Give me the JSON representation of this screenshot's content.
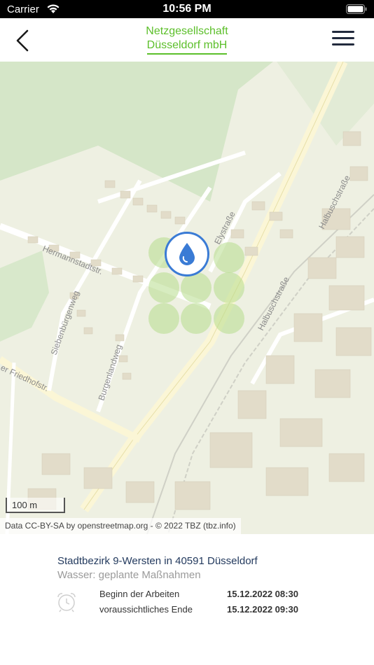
{
  "status_bar": {
    "carrier": "Carrier",
    "time": "10:56 PM"
  },
  "header": {
    "logo_line1": "Netzgesellschaft",
    "logo_line2": "Düsseldorf mbH"
  },
  "map": {
    "streets": [
      "Halbuschstraße",
      "Halbuschstraße",
      "Elystraße",
      "Hermannstadtstr.",
      "Siebenbürgenweg",
      "Burgenlandweg",
      "er Friedhofstr."
    ],
    "scale_label": "100 m",
    "attribution": "Data CC-BY-SA by openstreetmap.org - © 2022 TBZ (tbz.info)",
    "marker_type": "water-drop-icon",
    "colors": {
      "accent": "#5cbf2a",
      "marker": "#3a7bd5",
      "title": "#233a5e"
    }
  },
  "info": {
    "title": "Stadtbezirk 9-Wersten in 40591 Düsseldorf",
    "subtitle": "Wasser: geplante Maßnahmen",
    "start_label": "Beginn der Arbeiten",
    "start_value": "15.12.2022  08:30",
    "end_label": "voraussichtliches Ende",
    "end_value": "15.12.2022  09:30"
  }
}
